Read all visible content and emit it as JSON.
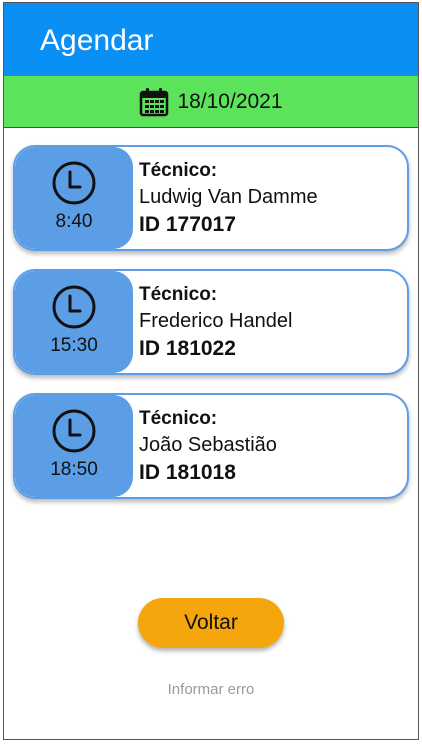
{
  "header": {
    "title": "Agendar"
  },
  "date_bar": {
    "icon": "calendar-icon",
    "date": "18/10/2021"
  },
  "appointments": [
    {
      "time": "8:40",
      "label": "Técnico:",
      "name": "Ludwig Van Damme",
      "id": "ID 177017"
    },
    {
      "time": "15:30",
      "label": "Técnico:",
      "name": "Frederico Handel",
      "id": "ID 181022"
    },
    {
      "time": "18:50",
      "label": "Técnico:",
      "name": "João Sebastião",
      "id": "ID 181018"
    }
  ],
  "actions": {
    "back_label": "Voltar",
    "report_label": "Informar erro"
  },
  "colors": {
    "header": "#0a8ff5",
    "date_bar": "#5ce35c",
    "card_accent": "#5b9ee6",
    "button": "#f4a60c",
    "link": "#9a9a9a"
  }
}
